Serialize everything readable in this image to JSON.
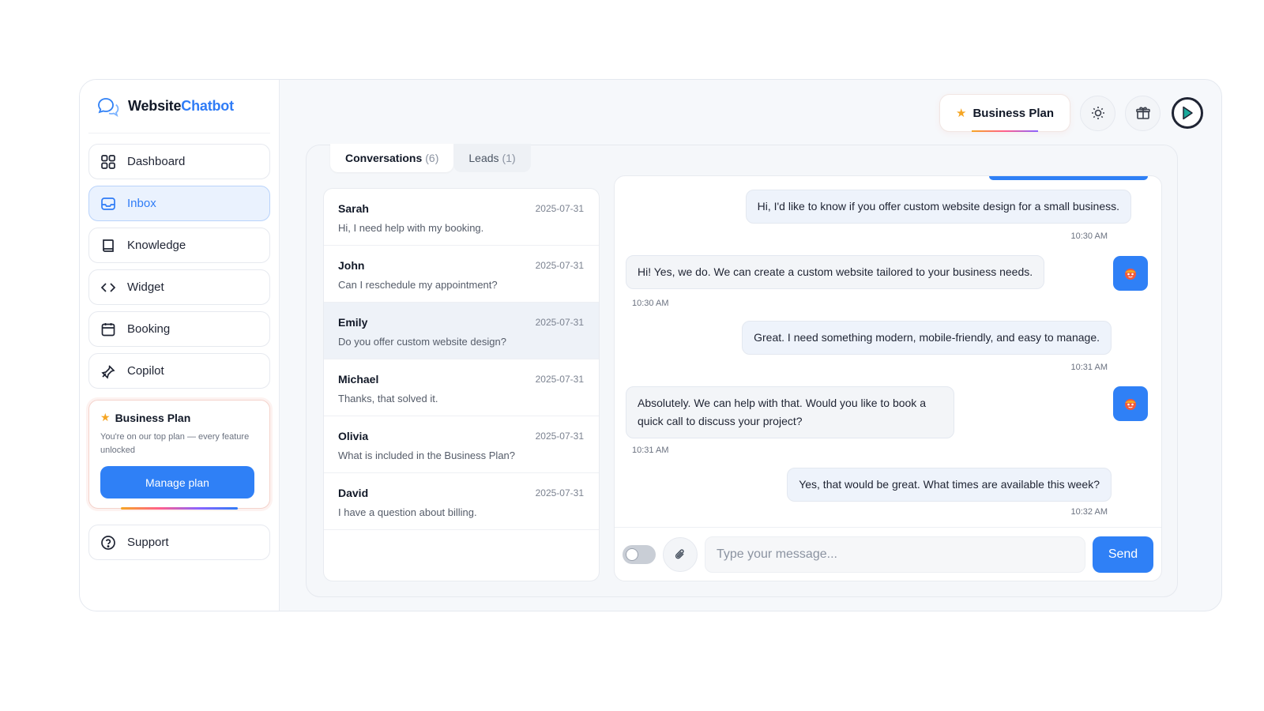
{
  "brand": {
    "part1": "Website",
    "part2": "Chatbot",
    "icon": "chat-bubbles-icon"
  },
  "sidebar": {
    "items": [
      {
        "label": "Dashboard",
        "icon": "grid-icon"
      },
      {
        "label": "Inbox",
        "icon": "inbox-icon",
        "active": true
      },
      {
        "label": "Knowledge",
        "icon": "book-icon"
      },
      {
        "label": "Widget",
        "icon": "code-icon"
      },
      {
        "label": "Booking",
        "icon": "calendar-icon"
      },
      {
        "label": "Copilot",
        "icon": "pen-icon"
      }
    ],
    "plan_card": {
      "title": "Business Plan",
      "description": "You're on our top plan — every feature unlocked",
      "button": "Manage plan"
    },
    "support": {
      "label": "Support",
      "icon": "help-circle-icon"
    }
  },
  "topbar": {
    "plan_label": "Business Plan",
    "theme_icon": "sun-icon",
    "gift_icon": "gift-icon",
    "play_icon": "play-icon"
  },
  "tabs": [
    {
      "label": "Conversations",
      "count": "(6)",
      "active": true
    },
    {
      "label": "Leads",
      "count": "(1)",
      "active": false
    }
  ],
  "conversations": [
    {
      "name": "Sarah",
      "date": "2025-07-31",
      "message": "Hi, I need help with my booking."
    },
    {
      "name": "John",
      "date": "2025-07-31",
      "message": "Can I reschedule my appointment?"
    },
    {
      "name": "Emily",
      "date": "2025-07-31",
      "message": "Do you offer custom website design?",
      "selected": true
    },
    {
      "name": "Michael",
      "date": "2025-07-31",
      "message": "Thanks, that solved it."
    },
    {
      "name": "Olivia",
      "date": "2025-07-31",
      "message": "What is included in the Business Plan?"
    },
    {
      "name": "David",
      "date": "2025-07-31",
      "message": "I have a question about billing."
    }
  ],
  "messages": [
    {
      "from": "user",
      "text": "Hi, I'd like to know if you offer custom website design for a small business.",
      "time": "10:30 AM"
    },
    {
      "from": "bot",
      "text": "Hi! Yes, we do. We can create a custom website tailored to your business needs.",
      "time": "10:30 AM"
    },
    {
      "from": "user",
      "text": "Great. I need something modern, mobile-friendly, and easy to manage.",
      "time": "10:31 AM"
    },
    {
      "from": "bot",
      "text": "Absolutely. We can help with that. Would you like to book a quick call to discuss your project?",
      "time": "10:31 AM"
    },
    {
      "from": "user",
      "text": "Yes, that would be great. What times are available this week?",
      "time": "10:32 AM"
    }
  ],
  "composer": {
    "placeholder": "Type your message...",
    "send": "Send"
  },
  "colors": {
    "accent": "#2f80f6",
    "star": "#f5a524"
  }
}
